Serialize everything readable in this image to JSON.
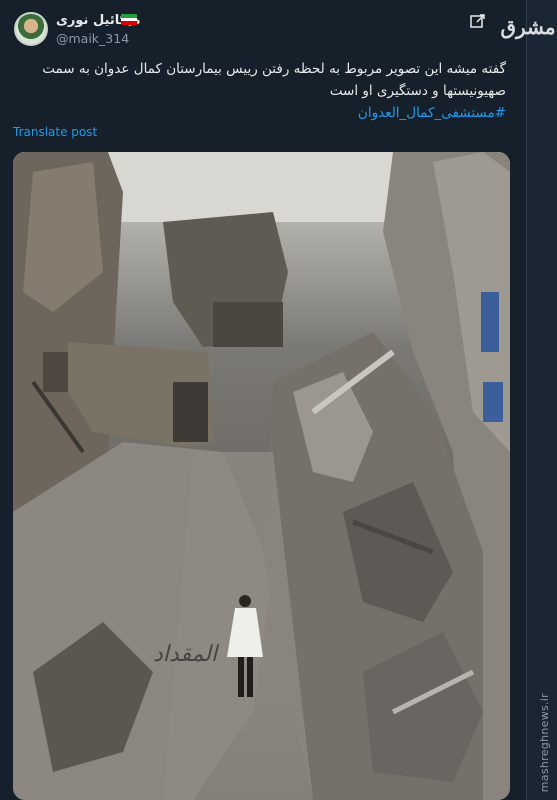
{
  "author": {
    "name": "میکائیل نوری",
    "handle": "@maik_314",
    "flag": [
      "#239f40",
      "#ffffff",
      "#da0000"
    ]
  },
  "tweet": {
    "text": "گفته میشه این تصویر مربوط به لحظه رفتن رییس بیمارستان کمال عدوان به سمت صهیونیستها و دستگیری او است",
    "hashtag": "#مستشفی_کمال_العدوان",
    "translate_label": "Translate post"
  },
  "branding": {
    "logo_text": "مشرق",
    "site": "mashreghnews.ir"
  },
  "media": {
    "watermark": "المقداد"
  },
  "colors": {
    "background": "#15202b",
    "link": "#1d9bf0",
    "secondary_text": "#8b98a5"
  }
}
